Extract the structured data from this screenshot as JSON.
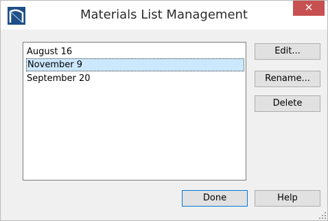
{
  "window": {
    "title": "Materials List Management",
    "close_glyph": "✕",
    "app_icon": "chief-architect-icon"
  },
  "list": {
    "items": [
      {
        "label": "August 16",
        "selected": false
      },
      {
        "label": "November 9",
        "selected": true
      },
      {
        "label": "September 20",
        "selected": false
      }
    ]
  },
  "buttons": {
    "edit": "Edit...",
    "rename": "Rename...",
    "delete": "Delete",
    "done": "Done",
    "help": "Help"
  },
  "colors": {
    "close_button": "#c75050",
    "selection": "#cce8ff",
    "default_button_border": "#0078d7"
  }
}
